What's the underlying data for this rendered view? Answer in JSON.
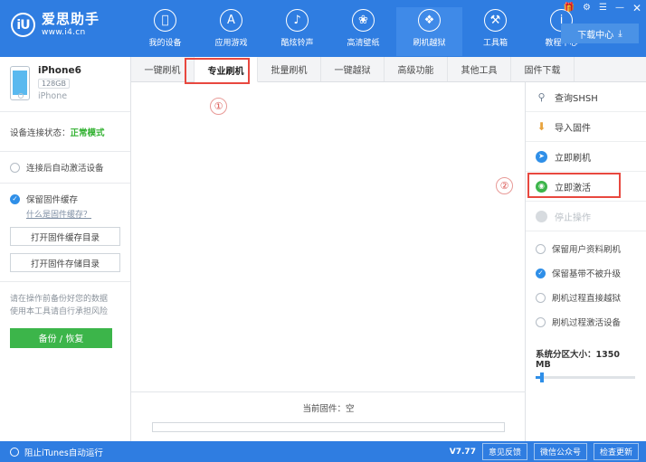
{
  "app": {
    "logo_cn": "爱思助手",
    "logo_url": "www.i4.cn",
    "logo_mark": "iU"
  },
  "window_controls": [
    {
      "name": "gift-icon",
      "glyph": "🎁"
    },
    {
      "name": "gear-icon",
      "glyph": "⚙"
    },
    {
      "name": "collapse-icon",
      "glyph": "☰"
    },
    {
      "name": "minimize-icon",
      "glyph": "—"
    },
    {
      "name": "close-icon",
      "glyph": "✕"
    }
  ],
  "download_center": {
    "label": "下载中心",
    "icon": "⤓"
  },
  "nav": [
    {
      "label": "我的设备",
      "icon": "",
      "active": false
    },
    {
      "label": "应用游戏",
      "icon": "A",
      "active": false
    },
    {
      "label": "酷炫铃声",
      "icon": "♪",
      "active": false
    },
    {
      "label": "高清壁纸",
      "icon": "❀",
      "active": false
    },
    {
      "label": "刷机越狱",
      "icon": "❖",
      "active": true
    },
    {
      "label": "工具箱",
      "icon": "⚒",
      "active": false
    },
    {
      "label": "教程中心",
      "icon": "i",
      "active": false
    }
  ],
  "tabs": [
    {
      "label": "一键刷机",
      "active": false
    },
    {
      "label": "专业刷机",
      "active": true
    },
    {
      "label": "批量刷机",
      "active": false
    },
    {
      "label": "一键越狱",
      "active": false
    },
    {
      "label": "高级功能",
      "active": false
    },
    {
      "label": "其他工具",
      "active": false
    },
    {
      "label": "固件下载",
      "active": false
    }
  ],
  "sidebar": {
    "device": {
      "name": "iPhone6",
      "capacity": "128GB",
      "model": "iPhone"
    },
    "connection": {
      "label": "设备连接状态：",
      "status": "正常模式"
    },
    "auto_activate": {
      "label": "连接后自动激活设备",
      "checked": false
    },
    "keep_cache": {
      "label": "保留固件缓存",
      "checked": true,
      "help_link": "什么是固件缓存？"
    },
    "buttons": [
      {
        "label": "打开固件缓存目录"
      },
      {
        "label": "打开固件存储目录"
      }
    ],
    "note_line1": "请在操作前备份好您的数据",
    "note_line2": "使用本工具请自行承担风险",
    "backup_button": "备份 / 恢复"
  },
  "center": {
    "firmware_status": "当前固件：空",
    "progress_percent": 0
  },
  "right_panel": {
    "actions": [
      {
        "label": "查询SHSH",
        "icon": "search-shsh-icon",
        "glyph": "🔍",
        "disabled": false
      },
      {
        "label": "导入固件",
        "icon": "import-firmware-icon",
        "glyph": "⬇",
        "disabled": false
      },
      {
        "label": "立即刷机",
        "icon": "flash-now-icon",
        "glyph": "➤",
        "disabled": false
      },
      {
        "label": "立即激活",
        "icon": "activate-now-icon",
        "glyph": "⊕",
        "disabled": false
      },
      {
        "label": "停止操作",
        "icon": "stop-operation-icon",
        "glyph": "■",
        "disabled": true
      }
    ],
    "options": [
      {
        "label": "保留用户资料刷机",
        "checked": false
      },
      {
        "label": "保留基带不被升级",
        "checked": true
      },
      {
        "label": "刷机过程直接越狱",
        "checked": false
      },
      {
        "label": "刷机过程激活设备",
        "checked": false
      }
    ],
    "slider": {
      "label": "系统分区大小：1350 MB",
      "value": 1350,
      "unit": "MB",
      "fill_percent": 6
    }
  },
  "bottom_bar": {
    "block_itunes": {
      "label": "阻止iTunes自动运行",
      "checked": false
    },
    "version": "V7.77",
    "buttons": [
      {
        "label": "意见反馈"
      },
      {
        "label": "微信公众号"
      },
      {
        "label": "检查更新"
      }
    ]
  },
  "annotations": [
    {
      "marker": "①"
    },
    {
      "marker": "②"
    }
  ],
  "colors": {
    "brand_blue": "#2f7de1",
    "accent_green": "#3cb54a",
    "status_green": "#34b233",
    "annotation_red": "#e8483f"
  }
}
